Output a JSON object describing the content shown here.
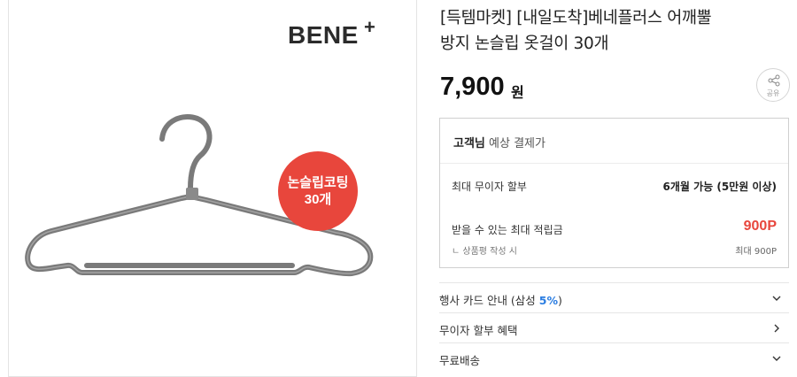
{
  "product": {
    "brand_logo": "BENE",
    "brand_plus": "+",
    "badge_line1": "논슬립코팅",
    "badge_line2": "30개",
    "title_line1": "[득템마켓] [내일도착]베네플러스 어깨뿔",
    "title_line2": "방지 논슬립 옷걸이 30개",
    "price": "7,900",
    "price_unit": "원"
  },
  "share": {
    "label": "공유",
    "icon": "share-icon"
  },
  "benefits": {
    "head_bold": "고객님",
    "head_rest": " 예상 결제가",
    "installment_label": "최대 무이자 할부",
    "installment_value": "6개월 가능 (5만원 이상)",
    "points_label": "받을 수 있는 최대 적립금",
    "points_value": "900P",
    "points_sub": "ㄴ 상품평 작성 시",
    "points_max": "최대 900P",
    "points_color": "#e8463c"
  },
  "accordion": {
    "card_label": "행사 카드 안내 (삼성 ",
    "card_highlight": "5%",
    "card_close": ")",
    "installment_label": "무이자 할부 혜택",
    "shipping_label": "무료배송",
    "highlight_color": "#2b7de1"
  }
}
